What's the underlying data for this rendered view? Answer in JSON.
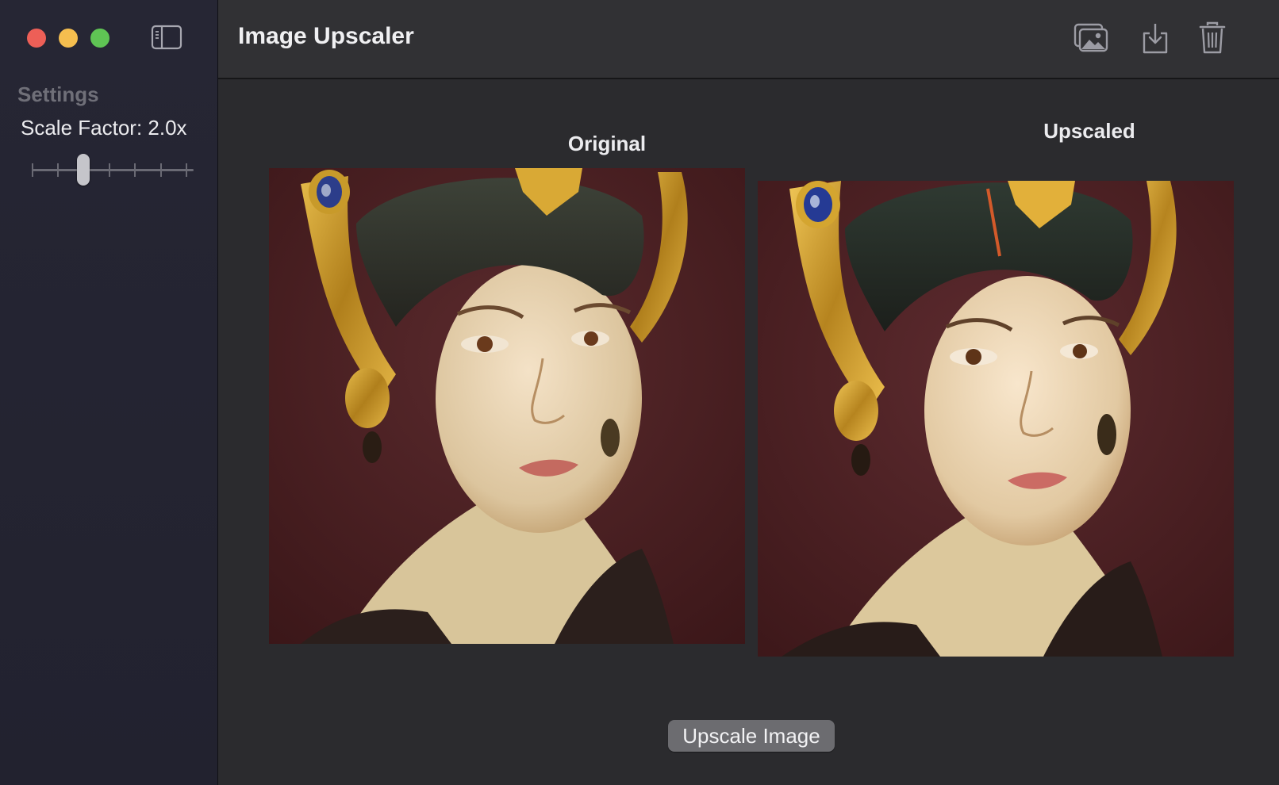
{
  "window": {
    "controls": [
      "close",
      "minimize",
      "zoom"
    ]
  },
  "sidebar": {
    "toggle_icon": "sidebar-left-icon",
    "settings_heading": "Settings",
    "scale_factor_label": "Scale Factor: 2.0x",
    "slider": {
      "value": 2.0,
      "fraction": 0.333,
      "tick_count": 7
    }
  },
  "toolbar": {
    "title": "Image Upscaler",
    "buttons": [
      {
        "icon": "photo-library-icon",
        "name": "open-image"
      },
      {
        "icon": "download-icon",
        "name": "save-image"
      },
      {
        "icon": "trash-icon",
        "name": "delete-image"
      }
    ]
  },
  "content": {
    "original_label": "Original",
    "upscaled_label": "Upscaled",
    "upscale_button_label": "Upscale Image"
  },
  "colors": {
    "close": "#ed5f57",
    "minimize": "#f5be4f",
    "zoom": "#5fc454",
    "button_bg": "#6c6c70",
    "portrait_background": "#4a1f22",
    "headdress_gold": "#c8962a"
  }
}
